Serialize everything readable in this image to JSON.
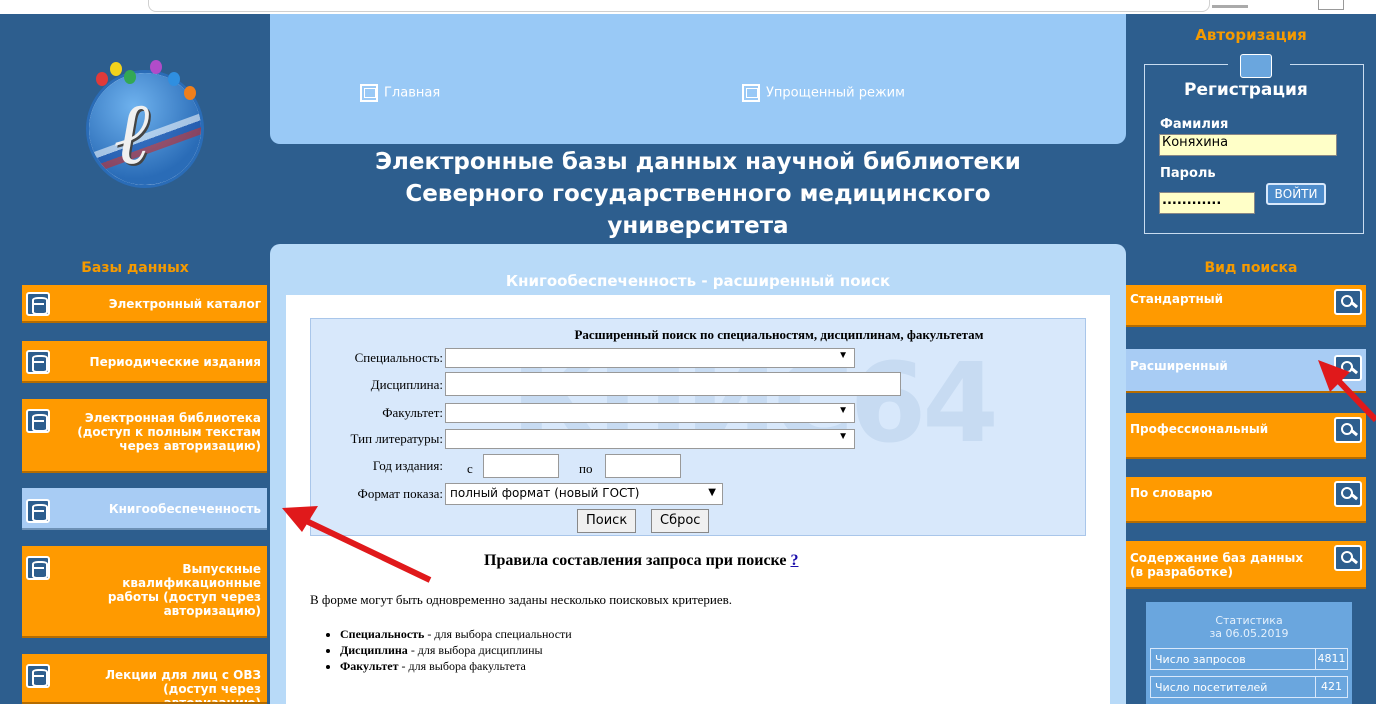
{
  "header": {
    "nav": [
      {
        "label": "Главная"
      },
      {
        "label": "Упрощенный режим"
      }
    ],
    "title": [
      "Электронные базы данных научной библиотеки",
      "Северного государственного медицинского",
      "университета"
    ]
  },
  "left": {
    "heading": "Базы данных",
    "items": [
      {
        "label": "Электронный каталог"
      },
      {
        "label": "Периодические издания"
      },
      {
        "label": "Электронная библиотека (доступ к полным текстам через авторизацию)"
      },
      {
        "label": "Книгообеспеченность",
        "active": true
      },
      {
        "label": "Выпускные квалификационные работы (доступ через авторизацию)"
      },
      {
        "label": "Лекции для лиц с ОВЗ (доступ через авторизацию)"
      }
    ]
  },
  "main": {
    "heading": "Книгообеспеченность - расширенный поиск",
    "watermark": "КПИС64",
    "form": {
      "title": "Расширенный поиск по специальностям, дисциплинам, факультетам",
      "specialty_label": "Специальность:",
      "specialty_value": "",
      "discipline_label": "Дисциплина:",
      "discipline_value": "",
      "faculty_label": "Факультет:",
      "faculty_value": "",
      "littype_label": "Тип литературы:",
      "littype_value": "",
      "year_label": "Год издания:",
      "year_from_label": "с",
      "year_to_label": "по",
      "format_label": "Формат показа:",
      "format_value": "полный формат (новый ГОСТ)",
      "search_btn": "Поиск",
      "reset_btn": "Сброс"
    },
    "rules_title": "Правила составления запроса при поиске",
    "rules_help": "?",
    "rules_intro": "В форме могут быть одновременно заданы несколько поисковых критериев.",
    "rules_list": [
      {
        "term": "Специальность",
        "desc": " - для выбора специальности"
      },
      {
        "term": "Дисциплина",
        "desc": " - для выбора дисциплины"
      },
      {
        "term": "Факультет",
        "desc": " - для выбора факультета"
      }
    ]
  },
  "auth": {
    "heading": "Авторизация",
    "register": "Регистрация",
    "surname_label": "Фамилия",
    "surname_value": "Коняхина",
    "password_label": "Пароль",
    "password_value": "............",
    "login_btn": "ВОЙТИ"
  },
  "right": {
    "heading": "Вид поиска",
    "items": [
      {
        "label": "Стандартный"
      },
      {
        "label": "Расширенный",
        "active": true
      },
      {
        "label": "Профессиональный"
      },
      {
        "label": "По словарю"
      },
      {
        "label": "Содержание баз данных (в разработке)"
      }
    ]
  },
  "stats": {
    "title": "Статистика",
    "date": "за 06.05.2019",
    "rows": [
      {
        "label": "Число запросов",
        "value": "4811"
      },
      {
        "label": "Число посетителей",
        "value": "421"
      }
    ]
  },
  "colors": {
    "bg": "#2d5e8e",
    "orange": "#ff9a00",
    "lightblue": "#99c9f6",
    "arrow": "#e0191b"
  }
}
